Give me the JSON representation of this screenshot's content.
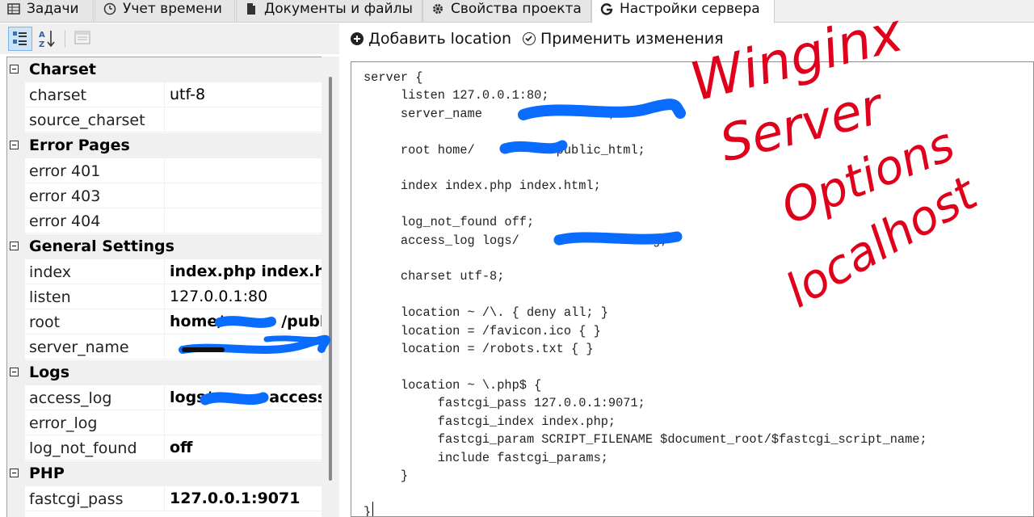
{
  "tabs": [
    {
      "label": "Задачи",
      "icon": "table-icon",
      "active": false
    },
    {
      "label": "Учет времени",
      "icon": "clock-icon",
      "active": false
    },
    {
      "label": "Документы и файлы",
      "icon": "document-icon",
      "active": false
    },
    {
      "label": "Свойства проекта",
      "icon": "gear-icon",
      "active": false
    },
    {
      "label": "Настройки сервера",
      "icon": "server-settings-icon",
      "active": true
    }
  ],
  "property_toolbar": {
    "buttons": [
      {
        "icon": "categorized-view-icon",
        "selected": true
      },
      {
        "icon": "sort-alphabetical-icon",
        "selected": false
      },
      {
        "icon": "property-pages-icon",
        "selected": false
      }
    ]
  },
  "property_grid": {
    "categories": [
      {
        "name": "Charset",
        "props": [
          {
            "name": "charset",
            "value": "utf-8",
            "bold": false
          },
          {
            "name": "source_charset",
            "value": "",
            "bold": false
          }
        ]
      },
      {
        "name": "Error Pages",
        "props": [
          {
            "name": "error 401",
            "value": "",
            "bold": false
          },
          {
            "name": "error 403",
            "value": "",
            "bold": false
          },
          {
            "name": "error 404",
            "value": "",
            "bold": false
          }
        ]
      },
      {
        "name": "General Settings",
        "props": [
          {
            "name": "index",
            "value": "index.php index.htm",
            "bold": true
          },
          {
            "name": "listen",
            "value": "127.0.0.1:80",
            "bold": false
          },
          {
            "name": "root",
            "value": "home/",
            "suffix": "/public",
            "bold": true,
            "redacted": true
          },
          {
            "name": "server_name",
            "value": "",
            "bold": false,
            "redacted": true
          }
        ]
      },
      {
        "name": "Logs",
        "props": [
          {
            "name": "access_log",
            "value": "logs/",
            "suffix": "-access.l",
            "bold": true,
            "redacted": true
          },
          {
            "name": "error_log",
            "value": "",
            "bold": false
          },
          {
            "name": "log_not_found",
            "value": "off",
            "bold": true
          }
        ]
      },
      {
        "name": "PHP",
        "props": [
          {
            "name": "fastcgi_pass",
            "value": "127.0.0.1:9071",
            "bold": true
          }
        ]
      }
    ]
  },
  "editor_toolbar": {
    "add_location_label": "Добавить location",
    "apply_changes_label": "Применить изменения"
  },
  "config_text": {
    "lines": [
      "server {",
      "\tlisten 127.0.0.1:80;",
      "\tserver_name                 ;",
      "",
      "\troot home/          /public_html;",
      "",
      "\tindex index.php index.html;",
      "",
      "\tlog_not_found off;",
      "\taccess_log logs/              s.log;",
      "",
      "\tcharset utf-8;",
      "",
      "\tlocation ~ /\\. { deny all; }",
      "\tlocation = /favicon.ico { }",
      "\tlocation = /robots.txt { }",
      "",
      "\tlocation ~ \\.php$ {",
      "\t\tfastcgi_pass 127.0.0.1:9071;",
      "\t\tfastcgi_index index.php;",
      "\t\tfastcgi_param SCRIPT_FILENAME $document_root/$fastcgi_script_name;",
      "\t\tinclude fastcgi_params;",
      "\t}",
      "",
      "}"
    ]
  },
  "annotation": {
    "lines": [
      "Winginx",
      "Server",
      "Options",
      "localhost"
    ],
    "color": "#e0001b"
  },
  "colors": {
    "redaction": "#0a6cff",
    "selected_button": "#cce4f7"
  }
}
